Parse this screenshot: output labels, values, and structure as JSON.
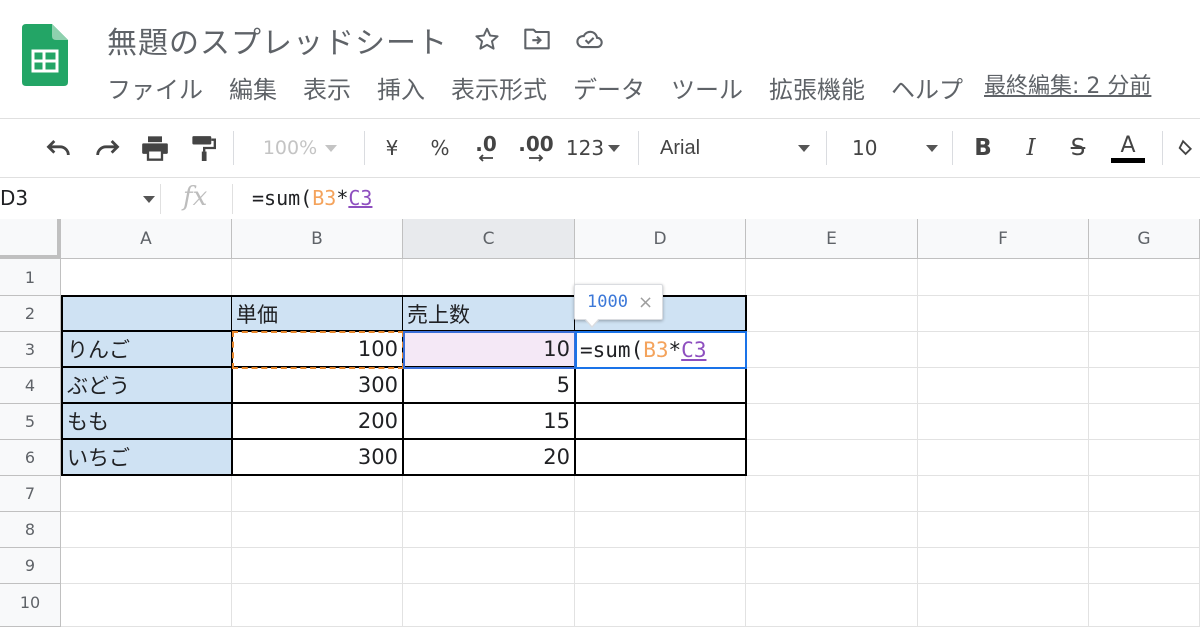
{
  "app": {
    "brand_color": "#23a566"
  },
  "title": {
    "doc_name": "無題のスプレッドシート",
    "star_icon": "star-icon",
    "move_icon": "folder-move-icon",
    "cloud_icon": "cloud-saved-icon"
  },
  "menu": [
    {
      "label": "ファイル"
    },
    {
      "label": "編集"
    },
    {
      "label": "表示"
    },
    {
      "label": "挿入"
    },
    {
      "label": "表示形式"
    },
    {
      "label": "データ"
    },
    {
      "label": "ツール"
    },
    {
      "label": "拡張機能"
    },
    {
      "label": "ヘルプ"
    }
  ],
  "last_edit": "最終編集: 2 分前",
  "toolbar": {
    "zoom": "100%",
    "currency": "¥",
    "percent": "%",
    "decrease_decimal": ".0",
    "increase_decimal": ".00",
    "number_format": "123",
    "font": "Arial",
    "font_size": "10",
    "bold": "B",
    "italic": "I",
    "strike": "S",
    "text_color": "A"
  },
  "formula_bar": {
    "name_box": "D3",
    "fx": "fx",
    "formula_prefix": "=sum(",
    "ref_b3": "B3",
    "op": "*",
    "ref_c3": "C3"
  },
  "grid": {
    "columns": [
      "A",
      "B",
      "C",
      "D",
      "E",
      "F",
      "G"
    ],
    "rows": [
      "1",
      "2",
      "3",
      "4",
      "5",
      "6",
      "7",
      "8",
      "9",
      "10"
    ],
    "active_column": "C",
    "headers": {
      "B": "単価",
      "C": "売上数"
    },
    "data": [
      {
        "name": "りんご",
        "price": "100",
        "qty": "10"
      },
      {
        "name": "ぶどう",
        "price": "300",
        "qty": "5"
      },
      {
        "name": "もも",
        "price": "200",
        "qty": "15"
      },
      {
        "name": "いちご",
        "price": "300",
        "qty": "20"
      }
    ],
    "header_fill": "#cfe2f3",
    "c3_fill": "#f4e8f6",
    "b3_ref_color": "#e6852a"
  },
  "formula_preview": {
    "value": "1000",
    "close": "×"
  },
  "cell_editor": {
    "formula_prefix": "=sum(",
    "ref_b3": "B3",
    "op": "*",
    "ref_c3": "C3"
  }
}
